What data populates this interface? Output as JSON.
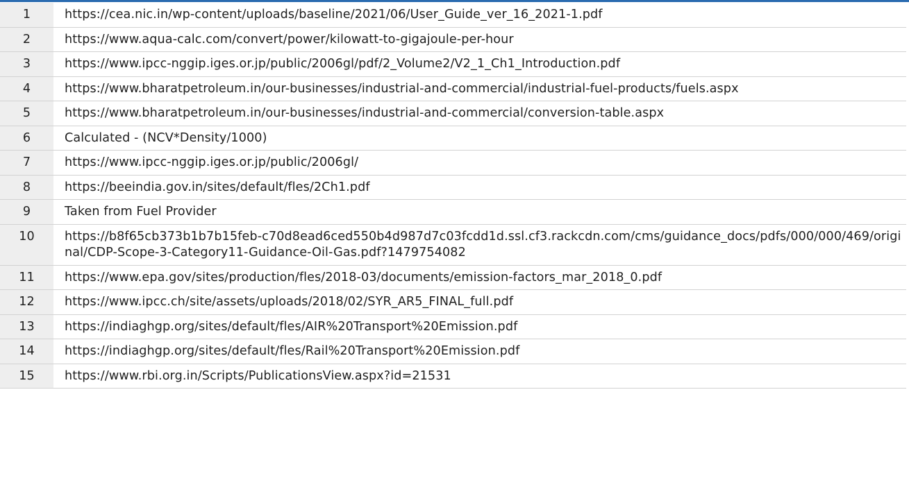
{
  "references": [
    {
      "num": "1",
      "source": "https://cea.nic.in/wp-content/uploads/baseline/2021/06/User_Guide_ver_16_2021-1.pdf"
    },
    {
      "num": "2",
      "source": "https://www.aqua-calc.com/convert/power/kilowatt-to-gigajoule-per-hour"
    },
    {
      "num": "3",
      "source": "https://www.ipcc-nggip.iges.or.jp/public/2006gl/pdf/2_Volume2/V2_1_Ch1_Introduction.pdf"
    },
    {
      "num": "4",
      "source": "https://www.bharatpetroleum.in/our-businesses/industrial-and-commercial/industrial-fuel-products/fuels.aspx"
    },
    {
      "num": "5",
      "source": "https://www.bharatpetroleum.in/our-businesses/industrial-and-commercial/conversion-table.aspx"
    },
    {
      "num": "6",
      "source": "Calculated - (NCV*Density/1000)"
    },
    {
      "num": "7",
      "source": "https://www.ipcc-nggip.iges.or.jp/public/2006gl/"
    },
    {
      "num": "8",
      "source": "https://beeindia.gov.in/sites/default/fles/2Ch1.pdf"
    },
    {
      "num": "9",
      "source": "Taken from Fuel Provider"
    },
    {
      "num": "10",
      "source": "https://b8f65cb373b1b7b15feb-c70d8ead6ced550b4d987d7c03fcdd1d.ssl.cf3.rackcdn.com/cms/guidance_docs/pdfs/000/000/469/original/CDP-Scope-3-Category11-Guidance-Oil-Gas.pdf?1479754082"
    },
    {
      "num": "11",
      "source": "https://www.epa.gov/sites/production/fles/2018-03/documents/emission-factors_mar_2018_0.pdf"
    },
    {
      "num": "12",
      "source": "https://www.ipcc.ch/site/assets/uploads/2018/02/SYR_AR5_FINAL_full.pdf"
    },
    {
      "num": "13",
      "source": "https://indiaghgp.org/sites/default/fles/AIR%20Transport%20Emission.pdf"
    },
    {
      "num": "14",
      "source": "https://indiaghgp.org/sites/default/fles/Rail%20Transport%20Emission.pdf"
    },
    {
      "num": "15",
      "source": "https://www.rbi.org.in/Scripts/PublicationsView.aspx?id=21531"
    }
  ]
}
